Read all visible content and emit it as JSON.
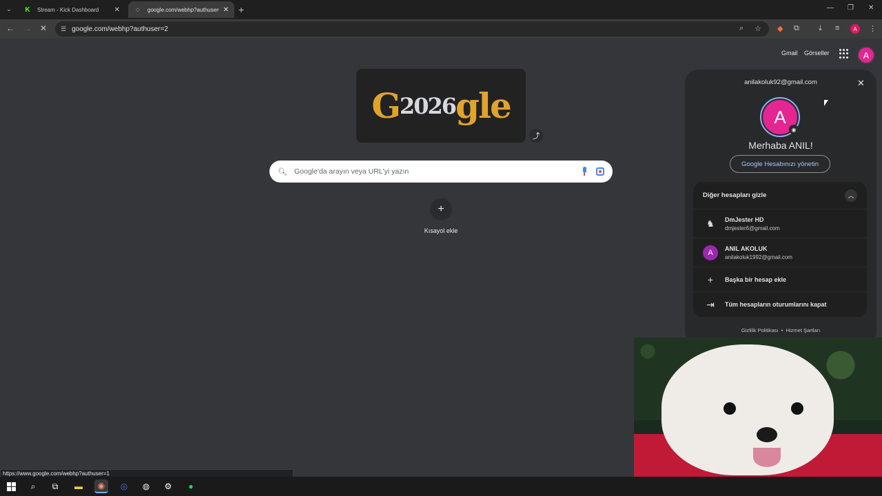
{
  "tabs": [
    {
      "title": "Stream - Kick Dashboard",
      "favicon": "K"
    },
    {
      "title": "google.com/webhp?authuser=",
      "favicon": "loading-icon"
    }
  ],
  "addressbar": {
    "url": "google.com/webhp?authuser=2"
  },
  "google": {
    "links": {
      "gmail": "Gmail",
      "images": "Görseller"
    },
    "avatar_letter": "A",
    "doodle_text": {
      "left": "G",
      "middle": "2026",
      "right": "gle"
    },
    "search_placeholder": "Google'da arayın veya URL'yi yazın",
    "shortcut_label": "Kısayol ekle"
  },
  "account_panel": {
    "email": "anilakoluk92@gmail.com",
    "avatar_letter": "A",
    "greeting": "Merhaba ANIL!",
    "manage_label": "Google Hesabınızı yönetin",
    "hide_accounts_label": "Diğer hesapları gizle",
    "accounts": [
      {
        "name": "DmJester HD",
        "email": "dmjester6@gmail.com",
        "icon": "♞"
      },
      {
        "name": "ANIL AKOLUK",
        "email": "anilakoluk1992@gmail.com",
        "icon": "A"
      }
    ],
    "add_account_label": "Başka bir hesap ekle",
    "sign_out_label": "Tüm hesapların oturumlarını kapat",
    "footer": {
      "privacy": "Gizlilik Politikası",
      "terms": "Hizmet Şartları",
      "separator": "•"
    }
  },
  "status_url": "https://www.google.com/webhp?authuser=1",
  "colors": {
    "accent": "#a8c7fa",
    "avatar": "#e52592",
    "kick_green": "#53fc18"
  }
}
